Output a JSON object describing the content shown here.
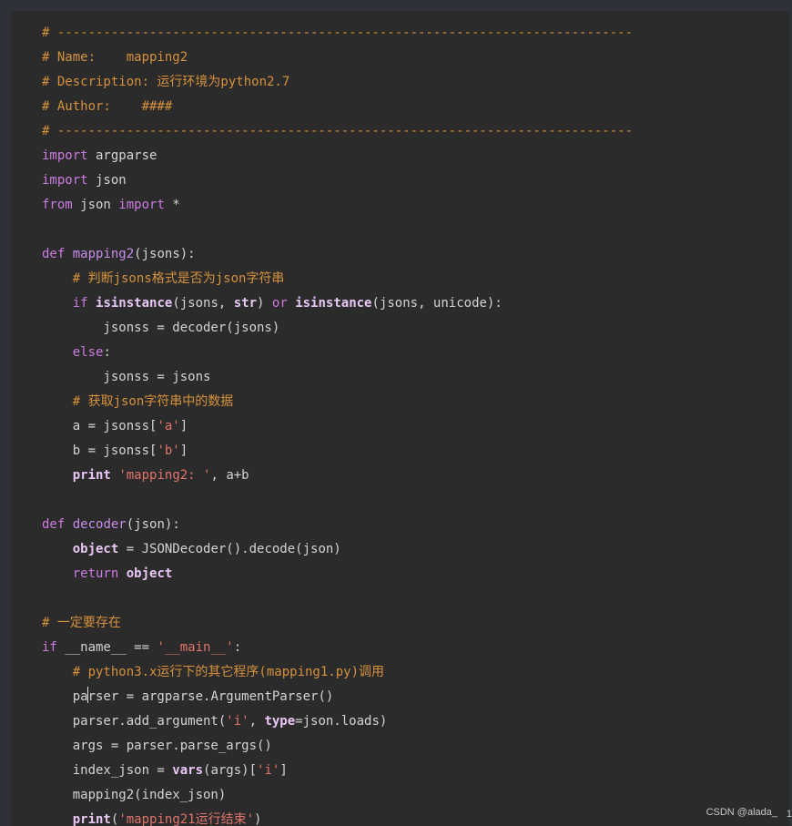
{
  "watermark": "CSDN @alada_",
  "edge_mark": "1",
  "cursor": {
    "line": 28,
    "after_text": "pa"
  },
  "code_lines": [
    [
      {
        "t": "# ---------------------------------------------------------------------------",
        "c": "comment"
      }
    ],
    [
      {
        "t": "# Name:    mapping2",
        "c": "comment"
      }
    ],
    [
      {
        "t": "# Description: 运行环境为python2.7",
        "c": "comment"
      }
    ],
    [
      {
        "t": "# Author:    ####",
        "c": "comment"
      }
    ],
    [
      {
        "t": "# ---------------------------------------------------------------------------",
        "c": "comment"
      }
    ],
    [
      {
        "t": "import",
        "c": "keyword"
      },
      {
        "t": " argparse",
        "c": "plain"
      }
    ],
    [
      {
        "t": "import",
        "c": "keyword"
      },
      {
        "t": " json",
        "c": "plain"
      }
    ],
    [
      {
        "t": "from",
        "c": "keyword"
      },
      {
        "t": " json ",
        "c": "plain"
      },
      {
        "t": "import",
        "c": "keyword"
      },
      {
        "t": " *",
        "c": "plain"
      }
    ],
    [
      {
        "t": "",
        "c": "plain"
      }
    ],
    [
      {
        "t": "def",
        "c": "keyword"
      },
      {
        "t": " ",
        "c": "plain"
      },
      {
        "t": "mapping2",
        "c": "fn"
      },
      {
        "t": "(jsons):",
        "c": "plain"
      }
    ],
    [
      {
        "t": "    ",
        "c": "plain"
      },
      {
        "t": "# 判断jsons格式是否为json字符串",
        "c": "comment"
      }
    ],
    [
      {
        "t": "    ",
        "c": "plain"
      },
      {
        "t": "if",
        "c": "keyword"
      },
      {
        "t": " ",
        "c": "plain"
      },
      {
        "t": "isinstance",
        "c": "builtin"
      },
      {
        "t": "(jsons, ",
        "c": "plain"
      },
      {
        "t": "str",
        "c": "builtin"
      },
      {
        "t": ") ",
        "c": "plain"
      },
      {
        "t": "or",
        "c": "keyword"
      },
      {
        "t": " ",
        "c": "plain"
      },
      {
        "t": "isinstance",
        "c": "builtin"
      },
      {
        "t": "(jsons, unicode):",
        "c": "plain"
      }
    ],
    [
      {
        "t": "        jsonss = decoder(jsons)",
        "c": "plain"
      }
    ],
    [
      {
        "t": "    ",
        "c": "plain"
      },
      {
        "t": "else",
        "c": "keyword"
      },
      {
        "t": ":",
        "c": "plain"
      }
    ],
    [
      {
        "t": "        jsonss = jsons",
        "c": "plain"
      }
    ],
    [
      {
        "t": "    ",
        "c": "plain"
      },
      {
        "t": "# 获取json字符串中的数据",
        "c": "comment"
      }
    ],
    [
      {
        "t": "    a = jsonss[",
        "c": "plain"
      },
      {
        "t": "'a'",
        "c": "string"
      },
      {
        "t": "]",
        "c": "plain"
      }
    ],
    [
      {
        "t": "    b = jsonss[",
        "c": "plain"
      },
      {
        "t": "'b'",
        "c": "string"
      },
      {
        "t": "]",
        "c": "plain"
      }
    ],
    [
      {
        "t": "    ",
        "c": "plain"
      },
      {
        "t": "print",
        "c": "builtin"
      },
      {
        "t": " ",
        "c": "plain"
      },
      {
        "t": "'mapping2: '",
        "c": "string"
      },
      {
        "t": ", a+b",
        "c": "plain"
      }
    ],
    [
      {
        "t": "",
        "c": "plain"
      }
    ],
    [
      {
        "t": "def",
        "c": "keyword"
      },
      {
        "t": " ",
        "c": "plain"
      },
      {
        "t": "decoder",
        "c": "fn"
      },
      {
        "t": "(json):",
        "c": "plain"
      }
    ],
    [
      {
        "t": "    ",
        "c": "plain"
      },
      {
        "t": "object",
        "c": "builtin"
      },
      {
        "t": " = JSONDecoder().decode(json)",
        "c": "plain"
      }
    ],
    [
      {
        "t": "    ",
        "c": "plain"
      },
      {
        "t": "return",
        "c": "keyword"
      },
      {
        "t": " ",
        "c": "plain"
      },
      {
        "t": "object",
        "c": "builtin"
      }
    ],
    [
      {
        "t": "",
        "c": "plain"
      }
    ],
    [
      {
        "t": "# 一定要存在",
        "c": "comment"
      }
    ],
    [
      {
        "t": "if",
        "c": "keyword"
      },
      {
        "t": " __name__ == ",
        "c": "plain"
      },
      {
        "t": "'__main__'",
        "c": "string"
      },
      {
        "t": ":",
        "c": "plain"
      }
    ],
    [
      {
        "t": "    ",
        "c": "plain"
      },
      {
        "t": "# python3.x运行下的其它程序(mapping1.py)调用",
        "c": "comment"
      }
    ],
    [
      {
        "t": "    parser = argparse.ArgumentParser()",
        "c": "plain"
      }
    ],
    [
      {
        "t": "    parser.add_argument(",
        "c": "plain"
      },
      {
        "t": "'i'",
        "c": "string"
      },
      {
        "t": ", ",
        "c": "plain"
      },
      {
        "t": "type",
        "c": "builtin"
      },
      {
        "t": "=json.loads)",
        "c": "plain"
      }
    ],
    [
      {
        "t": "    args = parser.parse_args()",
        "c": "plain"
      }
    ],
    [
      {
        "t": "    index_json = ",
        "c": "plain"
      },
      {
        "t": "vars",
        "c": "builtin"
      },
      {
        "t": "(args)[",
        "c": "plain"
      },
      {
        "t": "'i'",
        "c": "string"
      },
      {
        "t": "]",
        "c": "plain"
      }
    ],
    [
      {
        "t": "    mapping2(index_json)",
        "c": "plain"
      }
    ],
    [
      {
        "t": "    ",
        "c": "plain"
      },
      {
        "t": "print",
        "c": "builtin"
      },
      {
        "t": "(",
        "c": "plain"
      },
      {
        "t": "'mapping21运行结束'",
        "c": "string"
      },
      {
        "t": ")",
        "c": "plain"
      }
    ]
  ]
}
